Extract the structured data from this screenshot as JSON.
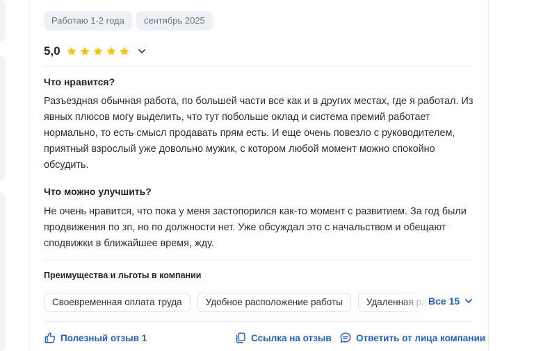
{
  "review": {
    "tags": [
      "Работаю 1-2 года",
      "сентябрь 2025"
    ],
    "rating": {
      "value_label": "5,0",
      "stars": 5,
      "max": 5
    },
    "likes": {
      "title": "Что нравится?",
      "text": "Разъездная обычная работа, по большей части все как и в других местах, где я работал. Из явных плюсов могу выделить, что тут побольше оклад и система премий работает нормально, то есть смысл продавать прям есть. И еще очень повезло с руководителем, приятный взрослый уже довольно мужик, с котором любой момент можно спокойно обсудить."
    },
    "improve": {
      "title": "Что можно улучшить?",
      "text": "Не очень нравится, что пока у меня застопорился как-то момент с развитием. За год были продвижения по зп, но по должности нет. Уже обсуждал это с начальством и обещают сподвижки в ближайшее время, жду."
    },
    "benefits": {
      "title": "Преимущества и льготы в компании",
      "chips": [
        "Своевременная оплата труда",
        "Удобное расположение работы",
        "Удаленная работа"
      ],
      "all_label": "Все 15"
    },
    "footer": {
      "helpful_label": "Полезный отзыв 1",
      "link_label": "Ссылка на отзыв",
      "reply_label": "Ответить от лица компании"
    }
  },
  "colors": {
    "accent": "#1f5fd6",
    "star": "#ffc107",
    "tag_bg": "#eef1f6"
  },
  "icons": [
    "star-icon",
    "chevron-down-icon",
    "thumbs-up-icon",
    "copy-link-icon",
    "chat-icon"
  ]
}
